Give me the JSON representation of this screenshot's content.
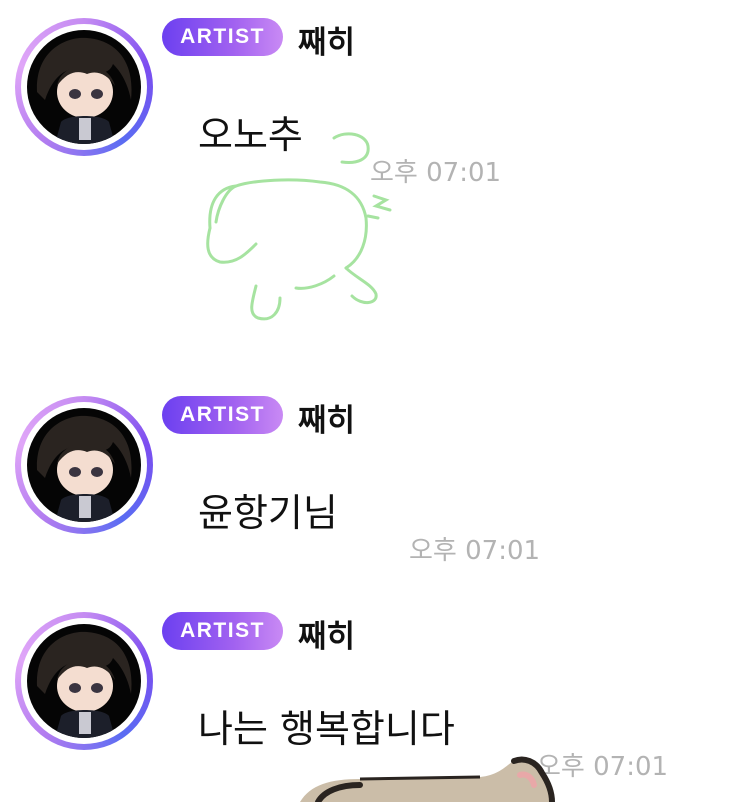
{
  "messages": [
    {
      "badge": "ARTIST",
      "sender": "째히",
      "text": "오노추",
      "time": "오후 07:01"
    },
    {
      "badge": "ARTIST",
      "sender": "째히",
      "text": "윤항기님",
      "time": "오후 07:01"
    },
    {
      "badge": "ARTIST",
      "sender": "째히",
      "text": "나는 행복합니다",
      "time": "오후 07:01"
    }
  ],
  "colors": {
    "badge_start": "#6c40f0",
    "badge_end": "#c98af4",
    "sticker_line": "#a6e3a0",
    "time": "#b3b3b3"
  }
}
